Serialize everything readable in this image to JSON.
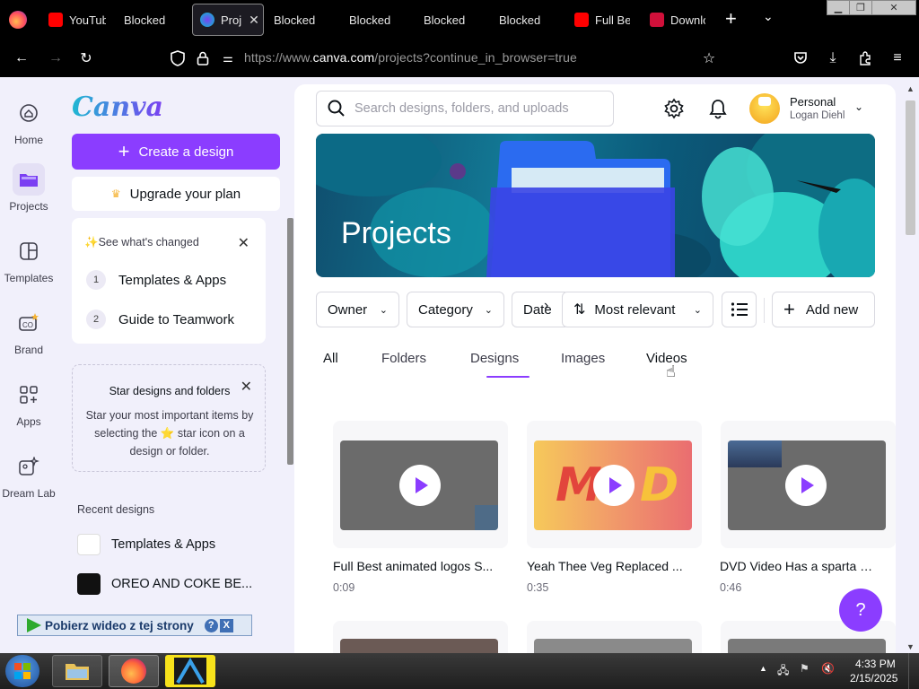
{
  "browser": {
    "tabs": [
      {
        "label": "YouTub",
        "favicon_color": "#ff0000"
      },
      {
        "label": "Blocked"
      },
      {
        "label": "Proj",
        "active": true,
        "favicon_color": "#00c4cc"
      },
      {
        "label": "Blocked"
      },
      {
        "label": "Blocked"
      },
      {
        "label": "Blocked"
      },
      {
        "label": "Blocked"
      },
      {
        "label": "Full Bes",
        "favicon_color": "#ff0000"
      },
      {
        "label": "Downlo",
        "favicon_color": "#d0103a"
      }
    ],
    "new_tab_label": "+",
    "url_prefix": "https://www.",
    "url_domain": "canva.com",
    "url_rest": "/projects?continue_in_browser=true"
  },
  "rail": [
    {
      "label": "Home",
      "icon": "home-icon"
    },
    {
      "label": "Projects",
      "icon": "folder-icon",
      "active": true
    },
    {
      "label": "Templates",
      "icon": "templates-icon"
    },
    {
      "label": "Brand",
      "icon": "brand-icon"
    },
    {
      "label": "Apps",
      "icon": "apps-icon"
    },
    {
      "label": "Dream Lab",
      "icon": "dream-lab-icon"
    }
  ],
  "sidebar": {
    "logo": "Canva",
    "create_label": "Create a design",
    "upgrade_label": "Upgrade your plan",
    "whats_changed": {
      "heading": "See what's changed",
      "items": [
        {
          "num": "1",
          "label": "Templates & Apps"
        },
        {
          "num": "2",
          "label": "Guide to Teamwork"
        }
      ]
    },
    "tip": {
      "title": "Star designs and folders",
      "body": "Star your most important items by selecting the ⭐ star icon on a design or folder."
    },
    "recent_heading": "Recent designs",
    "recent": [
      {
        "label": "Templates & Apps"
      },
      {
        "label": "OREO AND COKE BE..."
      }
    ]
  },
  "extension_bar": {
    "label": "Pobierz wideo z tej strony",
    "help": "?",
    "close": "X"
  },
  "header": {
    "search_placeholder": "Search designs, folders, and uploads",
    "account_type": "Personal",
    "account_name": "Logan Diehl"
  },
  "banner": {
    "title": "Projects"
  },
  "filters": {
    "owner": "Owner",
    "category": "Category",
    "date": "Date",
    "sort": "Most relevant",
    "add_new": "Add new"
  },
  "project_tabs": [
    {
      "label": "All"
    },
    {
      "label": "Folders"
    },
    {
      "label": "Designs",
      "active": true
    },
    {
      "label": "Images"
    },
    {
      "label": "Videos"
    }
  ],
  "videos": [
    {
      "title": "Full Best animated logos S...",
      "duration": "0:09"
    },
    {
      "title": "Yeah Thee Veg Replaced ...",
      "duration": "0:35"
    },
    {
      "title": "DVD Video Has a sparta g...",
      "duration": "0:46"
    }
  ],
  "help_label": "?",
  "taskbar": {
    "time": "4:33 PM",
    "date": "2/15/2025"
  },
  "colors": {
    "accent": "#8b3dff",
    "page_bg": "#f1f0fb"
  }
}
